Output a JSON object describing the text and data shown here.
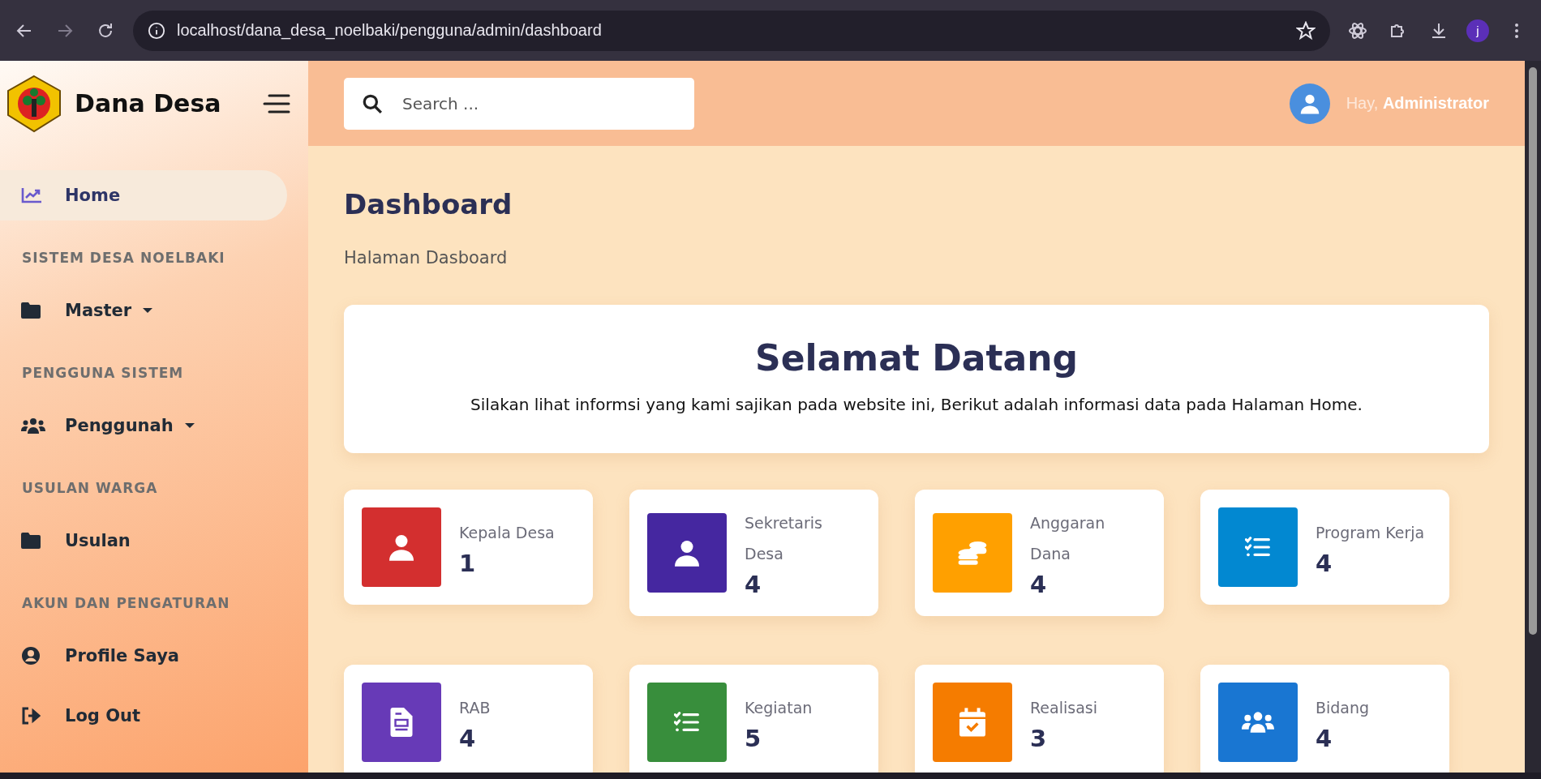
{
  "browser": {
    "url": "localhost/dana_desa_noelbaki/pengguna/admin/dashboard",
    "profile_initial": "j"
  },
  "sidebar": {
    "brand": "Dana Desa",
    "items": [
      {
        "kind": "link",
        "label": "Home",
        "selected": true,
        "dropdown": false
      },
      {
        "kind": "section",
        "label": "SISTEM DESA NOELBAKI"
      },
      {
        "kind": "link",
        "label": "Master",
        "selected": false,
        "dropdown": true
      },
      {
        "kind": "section",
        "label": "PENGGUNA SISTEM"
      },
      {
        "kind": "link",
        "label": "Penggunah",
        "selected": false,
        "dropdown": true
      },
      {
        "kind": "section",
        "label": "USULAN WARGA"
      },
      {
        "kind": "link",
        "label": "Usulan",
        "selected": false,
        "dropdown": false
      },
      {
        "kind": "section",
        "label": "AKUN DAN PENGATURAN"
      },
      {
        "kind": "link",
        "label": "Profile Saya",
        "selected": false,
        "dropdown": false
      },
      {
        "kind": "link",
        "label": "Log Out",
        "selected": false,
        "dropdown": false
      }
    ]
  },
  "header": {
    "search": {
      "placeholder": "Search ..."
    },
    "greeting": "Hay, **Administrator**"
  },
  "page": {
    "title": "Dashboard",
    "subtitle": "Halaman Dasboard"
  },
  "welcome": {
    "title": "Selamat Datang",
    "text": "Silakan lihat informsi yang kami sajikan pada website ini, Berikut adalah informasi data pada Halaman Home."
  },
  "stats": [
    {
      "label": "Kepala Desa",
      "value": "1",
      "color": "#d32f2f"
    },
    {
      "label": "Sekretaris Desa",
      "value": "4",
      "color": "#4527a0"
    },
    {
      "label": "Anggaran Dana",
      "value": "4",
      "color": "#ffa000"
    },
    {
      "label": "Program Kerja",
      "value": "4",
      "color": "#0288d1"
    },
    {
      "label": "RAB",
      "value": "4",
      "color": "#673ab7"
    },
    {
      "label": "Kegiatan",
      "value": "5",
      "color": "#388e3c"
    },
    {
      "label": "Realisasi",
      "value": "3",
      "color": "#f57c00"
    },
    {
      "label": "Bidang",
      "value": "4",
      "color": "#1976d2"
    }
  ]
}
